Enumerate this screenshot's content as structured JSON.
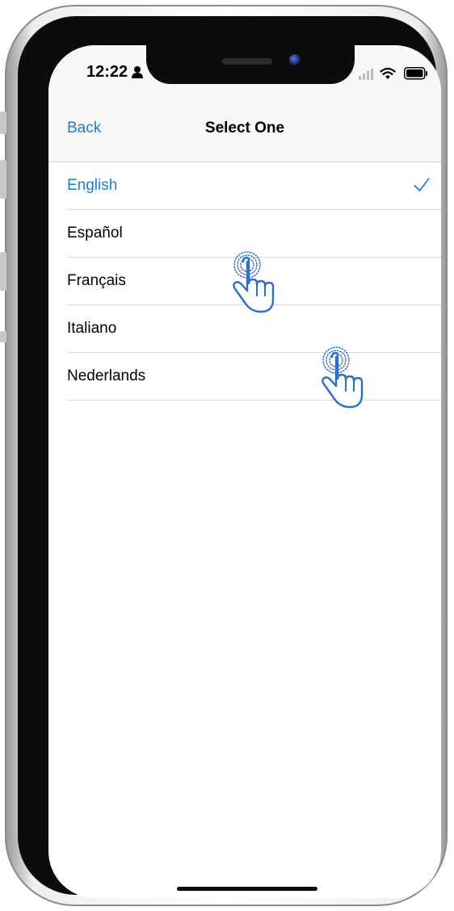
{
  "status_bar": {
    "time": "12:22",
    "icons": [
      "person-icon",
      "signal-icon",
      "wifi-icon",
      "battery-icon"
    ]
  },
  "nav": {
    "back_label": "Back",
    "title": "Select One"
  },
  "languages": [
    {
      "label": "English",
      "selected": true
    },
    {
      "label": "Español",
      "selected": false
    },
    {
      "label": "Français",
      "selected": false
    },
    {
      "label": "Italiano",
      "selected": false
    },
    {
      "label": "Nederlands",
      "selected": false
    }
  ],
  "colors": {
    "accent": "#1a7fe3",
    "nav_background": "#f8f8f8",
    "separator": "#dadadd",
    "tap_indicator": "#2c6fd1"
  },
  "overlay_icons": [
    "tap-hand-icon",
    "tap-hand-icon"
  ]
}
